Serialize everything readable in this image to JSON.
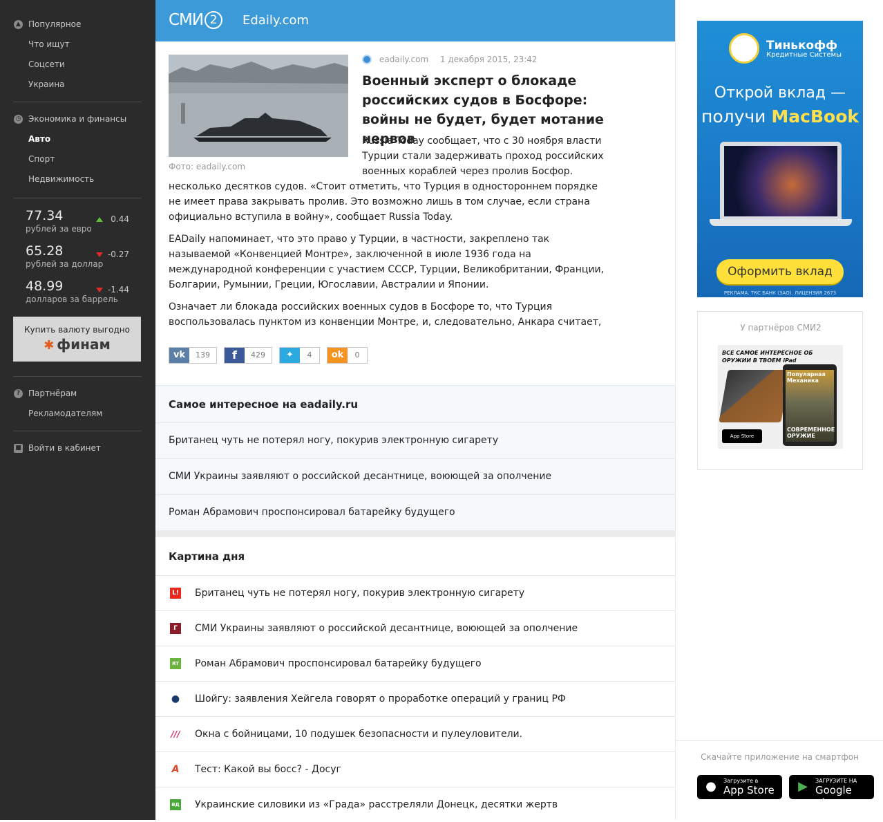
{
  "sidebar": {
    "groups": [
      {
        "items": [
          "Популярное",
          "Что ищут",
          "Соцсети",
          "Украина"
        ]
      },
      {
        "items": [
          "Экономика и финансы",
          "Авто",
          "Спорт",
          "Недвижимость"
        ]
      }
    ],
    "active_item": "Авто",
    "rates": [
      {
        "value": "77.34",
        "label": "рублей за евро",
        "change": "0.44",
        "direction": "up"
      },
      {
        "value": "65.28",
        "label": "рублей за доллар",
        "change": "-0.27",
        "direction": "down"
      },
      {
        "value": "48.99",
        "label": "долларов за баррель",
        "change": "-1.44",
        "direction": "down"
      }
    ],
    "finam": {
      "text": "Купить валюту выгодно",
      "logo": "финам"
    },
    "bottom_items": [
      "Партнёрам",
      "Рекламодателям"
    ],
    "login": "Войти в кабинет"
  },
  "header": {
    "logo": "СМИ",
    "logo_num": "2",
    "site": "Edaily.com"
  },
  "article": {
    "source": "eadaily.com",
    "date": "1 декабря 2015, 23:42",
    "title": "Военный эксперт о блокаде российских судов в Босфоре: войны не будет, будет мотание нервов",
    "photo_caption": "Фото: eadaily.com",
    "p1_lines": [
      "Russia Today сообщает, что с 30 ноября власти",
      "Турции стали задерживать проход российских",
      "военных кораблей через пролив Босфор."
    ],
    "p1_cont": "несколько десятков судов. «Стоит отметить, что Турция в одностороннем порядке не имеет права закрывать пролив. Это возможно лишь в том случае, если страна официально вступила в войну», сообщает Russia Today.",
    "p2": "EADaily напоминает, что это право у Турции, в частности, закреплено так называемой «Конвенцией Монтре», заключенной в июле 1936 года на международной конференции с участием СССР, Турции, Великобритании, Франции, Болгарии, Румынии, Греции, Югославии, Австралии и Японии.",
    "p3": "Означает ли блокада российских военных судов в Босфоре то, что Турция воспользовалась пунктом из конвенции Монтре, и, следовательно, Анкара считает, что Россия находится с"
  },
  "share": [
    {
      "network": "vk",
      "count": "139",
      "color": "#5b7fa6"
    },
    {
      "network": "facebook",
      "count": "429",
      "color": "#3b5998"
    },
    {
      "network": "twitter",
      "count": "4",
      "color": "#2ba9e1"
    },
    {
      "network": "odnoklassniki",
      "count": "0",
      "color": "#f4931f"
    }
  ],
  "interesting": {
    "title": "Самое интересное на eadaily.ru",
    "items": [
      "Британец чуть не потерял ногу, покурив электронную сигарету",
      "СМИ Украины заявляют о российской десантнице, воюющей за ополчение",
      "Роман Абрамович проспонсировал батарейку будущего"
    ]
  },
  "day": {
    "title": "Картина дня",
    "items": [
      {
        "text": "Британец чуть не потерял ногу, покурив электронную сигарету",
        "icon": "L!",
        "color": "#e8271f"
      },
      {
        "text": "СМИ Украины заявляют о российской десантнице, воюющей за ополчение",
        "icon": "Г",
        "color": "#8b1c2a"
      },
      {
        "text": "Роман Абрамович проспонсировал батарейку будущего",
        "icon": "RT",
        "color": "#6cb33f"
      },
      {
        "text": "Шойгу: заявления Хейгела говорят о проработке операций у границ РФ",
        "icon": "●",
        "color": "#1a3a6e"
      },
      {
        "text": "Окна с бойницами, 10 подушек безопасности и пулеуловители.",
        "icon": "///",
        "color": "#d62a6a"
      },
      {
        "text": "Тест: Какой вы босс? - Досуг",
        "icon": "А",
        "color": "#e0452a"
      },
      {
        "text": "Украинские силовики из «Града» расстреляли Донецк, десятки жертв",
        "icon": "ВД",
        "color": "#4aa838"
      }
    ]
  },
  "ads": {
    "tinkoff": {
      "brand": "Тинькофф",
      "sub": "Кредитные Системы",
      "line1": "Открой вклад —",
      "line2_pre": "получи ",
      "line2_accent": "MacBook",
      "button": "Оформить вклад",
      "license": "РЕКЛАМА. ТКС БАНК (ЗАО). ЛИЦЕНЗИЯ 2673"
    },
    "partners": {
      "caption": "У партнёров СМИ2",
      "headline": "ВСЕ САМОЕ ИНТЕРЕСНОЕ ОБ ОРУЖИИ В ТВОЕМ iPad",
      "mag": "Популярная Механика",
      "mag2": "СОВРЕМЕННОЕ ОРУЖИЕ",
      "appstore": "App Store"
    }
  },
  "apps": {
    "caption": "Скачайте приложение на смартфон",
    "appstore_small": "Загрузите в",
    "appstore_big": "App Store",
    "gplay_small": "ЗАГРУЗИТЕ НА",
    "gplay_big": "Google play"
  }
}
